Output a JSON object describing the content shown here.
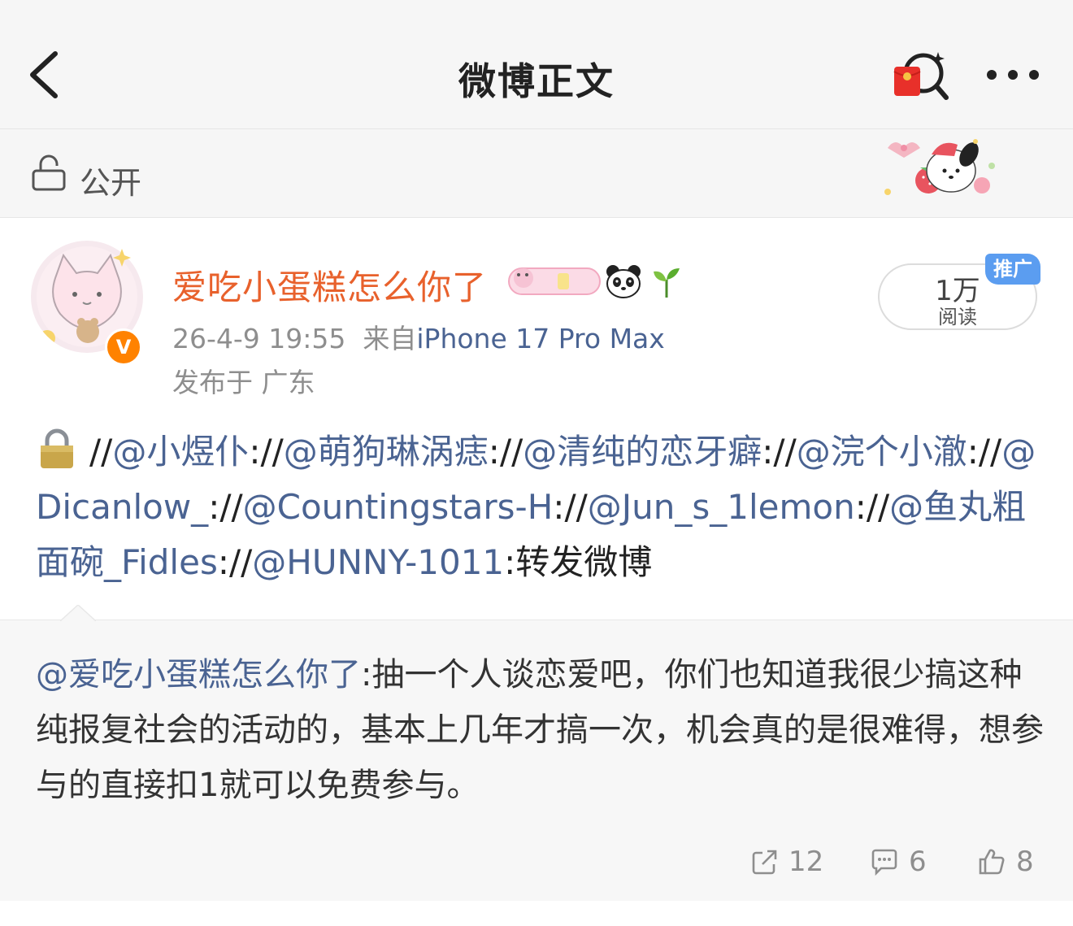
{
  "nav": {
    "title": "微博正文",
    "back_icon": "chevron-left-icon",
    "redpack_icon": "red-packet-search-icon",
    "more_icon": "more-dots-icon"
  },
  "visibility": {
    "icon": "lock-open-icon",
    "label": "公开"
  },
  "user": {
    "name": "爱吃小蛋糕怎么你了",
    "verified_badge": "V",
    "time": "26-4-9 19:55",
    "source_prefix": "来自",
    "source": "iPhone 17 Pro Max",
    "location": "发布于 广东"
  },
  "reads": {
    "count": "1万",
    "label": "阅读",
    "promo_label": "推广"
  },
  "post": {
    "segments": [
      {
        "text": "//",
        "link": false
      },
      {
        "text": "@小煜仆",
        "link": true
      },
      {
        "text": "://",
        "link": false
      },
      {
        "text": "@萌狗琳涡痣",
        "link": true
      },
      {
        "text": "://",
        "link": false
      },
      {
        "text": "@清纯的恋牙癖",
        "link": true
      },
      {
        "text": "://",
        "link": false
      },
      {
        "text": "@浣个小澈",
        "link": true
      },
      {
        "text": "://",
        "link": false
      },
      {
        "text": "@Dicanlow_",
        "link": true
      },
      {
        "text": "://",
        "link": false
      },
      {
        "text": "@Countingstars-H",
        "link": true
      },
      {
        "text": "://",
        "link": false
      },
      {
        "text": "@Jun_s_1lemon",
        "link": true
      },
      {
        "text": "://",
        "link": false
      },
      {
        "text": "@鱼丸粗面碗_Fidles",
        "link": true
      },
      {
        "text": "://",
        "link": false
      },
      {
        "text": "@HUNNY-1011",
        "link": true
      },
      {
        "text": ":转发微博",
        "link": false
      }
    ]
  },
  "retweet": {
    "author": "@爱吃小蛋糕怎么你了",
    "text": ":抽一个人谈恋爱吧，你们也知道我很少搞这种纯报复社会的活动的，基本上几年才搞一次，机会真的是很难得，想参与的直接扣1就可以免费参与。",
    "shares": "12",
    "comments": "6",
    "likes": "8"
  },
  "colors": {
    "link": "#4a6392",
    "username": "#e8612c",
    "verified": "#ff8200",
    "promo": "#5b9df0"
  }
}
